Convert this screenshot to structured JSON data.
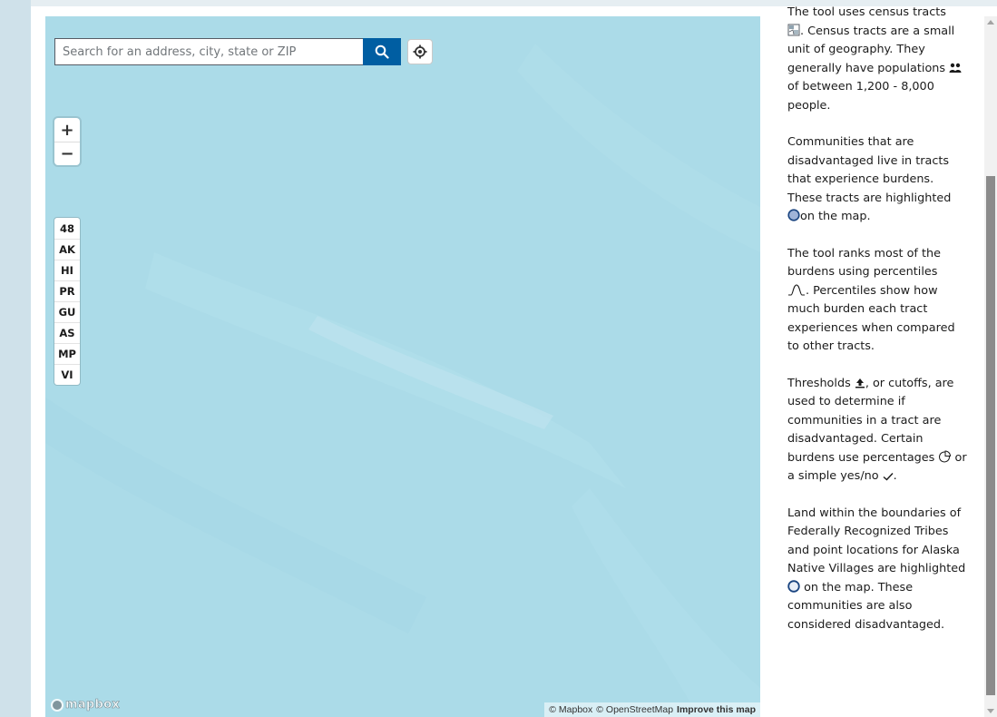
{
  "search": {
    "placeholder": "Search for an address, city, state or ZIP"
  },
  "zoom": {
    "in_label": "+",
    "out_label": "−"
  },
  "territories": [
    "48",
    "AK",
    "HI",
    "PR",
    "GU",
    "AS",
    "MP",
    "VI"
  ],
  "map": {
    "logo_text": "mapbox",
    "attribution": {
      "mapbox": "© Mapbox",
      "osm": "© OpenStreetMap",
      "improve": "Improve this map"
    },
    "water_color": "#abdbe8"
  },
  "panel": {
    "p1": {
      "a": "The tool uses census tracts",
      "b": ". Census tracts are a small unit of geography. They generally have populations",
      "c": "of between 1,200 - 8,000 people."
    },
    "p2": {
      "a": "Communities that are disadvantaged live in tracts that experience burdens. These tracts are highlighted",
      "b": "on the map."
    },
    "p3": {
      "a": "The tool ranks most of the burdens using percentiles",
      "b": ". Percentiles show how much burden each tract experiences when compared to other tracts."
    },
    "p4": {
      "a": "Thresholds",
      "b": ", or cutoffs, are used to determine if communities in a tract are disadvantaged. Certain burdens use percentages",
      "c": "or a simple yes/no",
      "d": "."
    },
    "p5": {
      "a": "Land within the boundaries of Federally Recognized Tribes and point locations for Alaska Native Villages are highlighted",
      "b": "on the map. These communities are also considered disadvantaged."
    }
  },
  "colors": {
    "accent": "#005ea2",
    "highlight_fill": "#9fb3d8",
    "highlight_stroke": "#1a4480"
  }
}
